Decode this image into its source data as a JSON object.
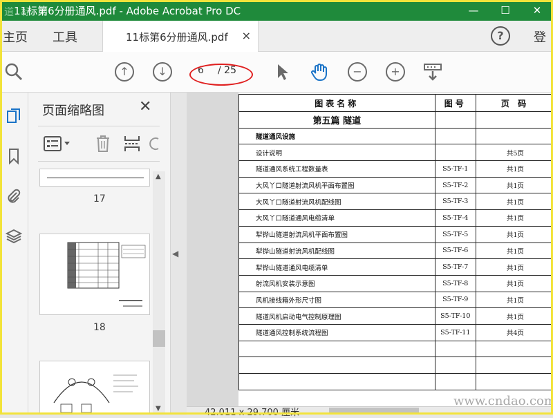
{
  "window": {
    "title": "11标第6分册通风.pdf - Adobe Acrobat Pro DC",
    "watermark_logo": "道 标 网",
    "min_label": "—",
    "max_label": "☐",
    "close_label": "✕"
  },
  "tabs": {
    "home": "主页",
    "tools": "工具",
    "doc": "11标第6分册通风.pdf",
    "doc_close": "×",
    "help": "?",
    "signin": "登"
  },
  "toolbar": {
    "page_current": "6",
    "page_total": "/ 25",
    "up_glyph": "↑",
    "down_glyph": "↓",
    "zoom_out_glyph": "−",
    "zoom_in_glyph": "+"
  },
  "thumbnail_panel": {
    "title": "页面缩略图",
    "close": "✕",
    "pages": [
      "17",
      "18"
    ]
  },
  "document": {
    "headers": [
      "图表名称",
      "图号",
      "页 码"
    ],
    "section_title": "第五篇  隧道",
    "rows": [
      {
        "name": "隧道通风设施",
        "code": "",
        "pages": ""
      },
      {
        "name": "设计说明",
        "code": "",
        "pages": "共5页"
      },
      {
        "name": "隧道通风系统工程数量表",
        "code": "S5-TF-1",
        "pages": "共1页"
      },
      {
        "name": "大风丫口隧道射流风机平面布置图",
        "code": "S5-TF-2",
        "pages": "共1页"
      },
      {
        "name": "大风丫口隧道射流风机配线图",
        "code": "S5-TF-3",
        "pages": "共1页"
      },
      {
        "name": "大风丫口隧道通风电缆清单",
        "code": "S5-TF-4",
        "pages": "共1页"
      },
      {
        "name": "犁铧山隧道射流风机平面布置图",
        "code": "S5-TF-5",
        "pages": "共1页"
      },
      {
        "name": "犁铧山隧道射流风机配线图",
        "code": "S5-TF-6",
        "pages": "共1页"
      },
      {
        "name": "犁铧山隧道通风电缆清单",
        "code": "S5-TF-7",
        "pages": "共1页"
      },
      {
        "name": "射流风机安装示意图",
        "code": "S5-TF-8",
        "pages": "共1页"
      },
      {
        "name": "风机接线箱外形尺寸图",
        "code": "S5-TF-9",
        "pages": "共1页"
      },
      {
        "name": "隧道风机启动电气控制原理图",
        "code": "S5-TF-10",
        "pages": "共1页"
      },
      {
        "name": "隧道通风控制系统流程图",
        "code": "S5-TF-11",
        "pages": "共4页"
      }
    ]
  },
  "status": {
    "dimensions": "42.011 x 29.700 厘米"
  },
  "site_watermark": "www.cndao.com",
  "colors": {
    "titlebar": "#1f8a3b",
    "accent_blue": "#1a73c7",
    "highlight_red": "#e02020",
    "frame_yellow": "#f2e33a"
  }
}
